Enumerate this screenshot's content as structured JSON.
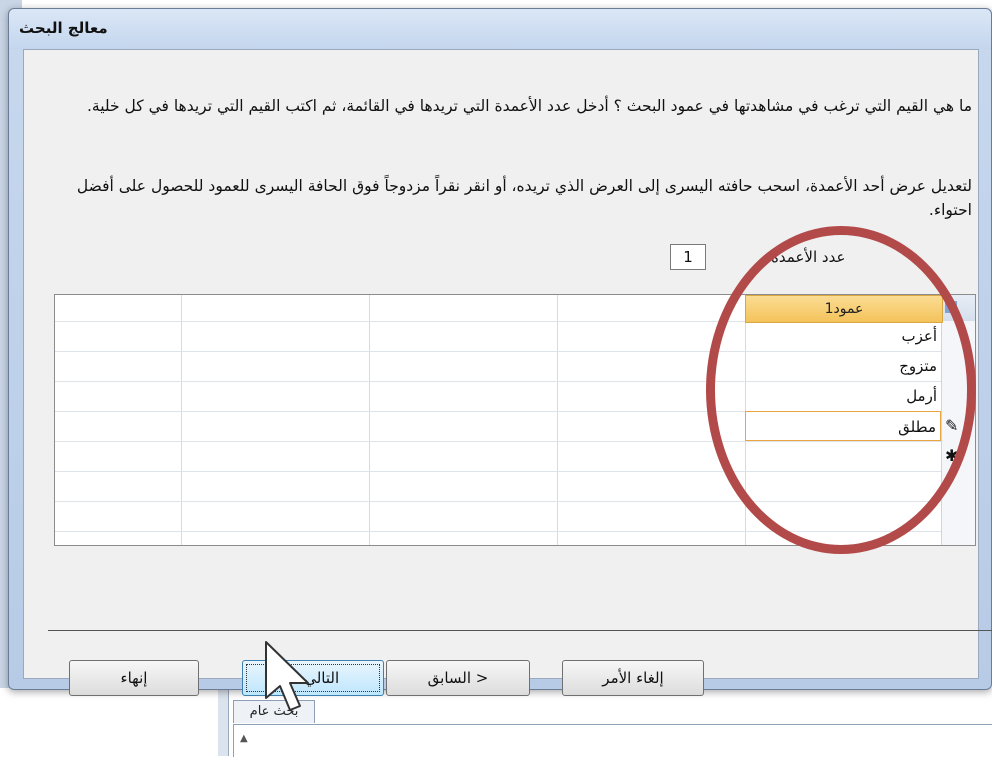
{
  "dialog": {
    "title": "معالج البحث",
    "instruction_1": "ما هي القيم التي ترغب في مشاهدتها في عمود البحث ؟ أدخل عدد الأعمدة التي تريدها في القائمة، ثم اكتب القيم التي تريدها في كل خلية.",
    "instruction_2": "لتعديل عرض أحد الأعمدة، اسحب حافته اليسرى إلى العرض الذي تريده، أو انقر نقراً مزدوجاً فوق الحافة اليسرى للعمود للحصول على أفضل احتواء.",
    "column_count_label": "عدد الأعمدة:",
    "column_count_value": "1"
  },
  "grid": {
    "column_header": "عمود1",
    "rows": [
      "أعزب",
      "متزوج",
      "أرمل",
      "مطلق"
    ],
    "active_row_index": 3,
    "editing_icon": "pencil-icon",
    "new_row_icon": "asterisk-icon"
  },
  "buttons": {
    "finish": "إنهاء",
    "next": "التالي >",
    "back": "< السابق",
    "cancel": "إلغاء الأمر"
  },
  "background_app": {
    "tab_label": "بحث عام"
  },
  "colors": {
    "annotation_circle": "#b34a4a",
    "header_highlight": "#f4c35a",
    "dialog_frame": "#c7d8ee"
  }
}
